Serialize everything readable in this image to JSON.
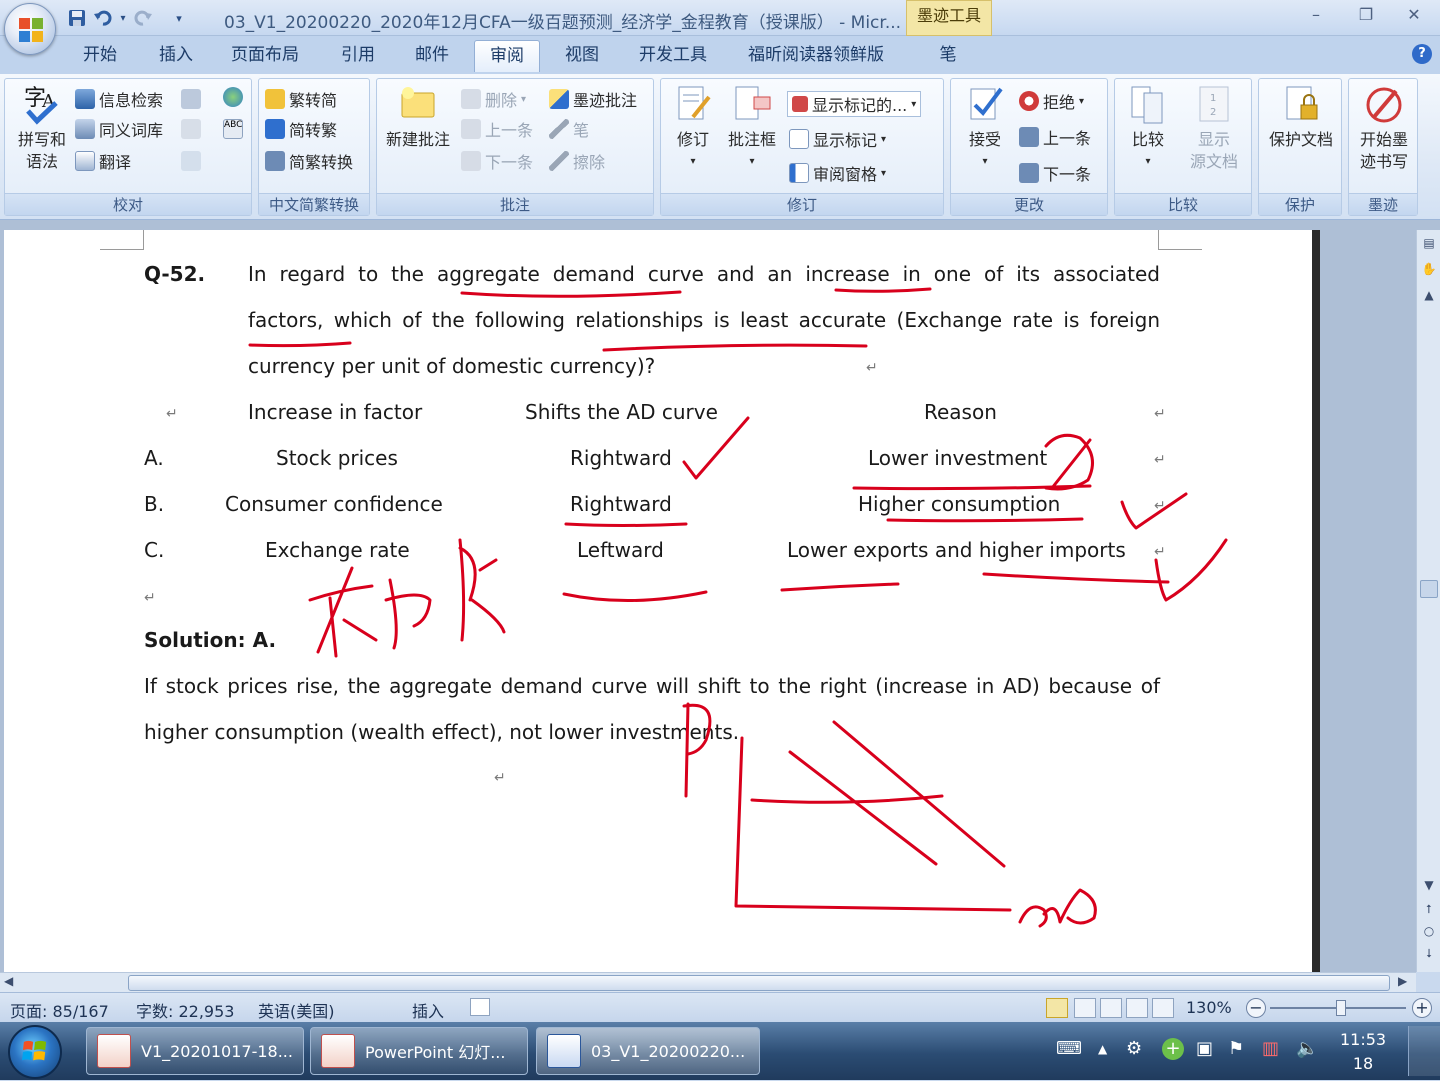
{
  "window": {
    "title": "03_V1_20200220_2020年12月CFA一级百题预测_经济学_金程教育（授课版） - Micr...",
    "contextual_tab": "墨迹工具",
    "controls": [
      "–",
      "❐",
      "✕"
    ]
  },
  "quick_access": [
    "save",
    "undo",
    "redo",
    "customize"
  ],
  "tabs": [
    "开始",
    "插入",
    "页面布局",
    "引用",
    "邮件",
    "审阅",
    "视图",
    "开发工具",
    "福昕阅读器领鲜版",
    "笔"
  ],
  "active_tab": "审阅",
  "ribbon": {
    "proofing": {
      "label": "校对",
      "spelling": [
        "拼写和",
        "语法"
      ],
      "research": "信息检索",
      "thesaurus": "同义词库",
      "translate": "翻译"
    },
    "chinese_conversion": {
      "label": "中文简繁转换",
      "to_simplified": "繁转简",
      "to_traditional": "简转繁",
      "convert": "简繁转换"
    },
    "comments": {
      "label": "批注",
      "new_comment": "新建批注",
      "delete": "删除",
      "previous": "上一条",
      "next": "下一条",
      "ink_comment": "墨迹批注",
      "pen": "笔",
      "erase": "擦除"
    },
    "tracking": {
      "label": "修订",
      "track_changes": "修订",
      "balloons": "批注框",
      "display_markup": "显示标记的...",
      "show_markup": "显示标记",
      "reviewing_pane": "审阅窗格"
    },
    "changes": {
      "label": "更改",
      "accept": "接受",
      "reject": "拒绝",
      "previous": "上一条",
      "next": "下一条"
    },
    "compare": {
      "label": "比较",
      "compare": "比较",
      "show_source": [
        "显示",
        "源文档"
      ]
    },
    "protect": {
      "label": "保护",
      "protect_document": "保护文档"
    },
    "ink": {
      "label": "墨迹",
      "start_inking": [
        "开始墨",
        "迹书写"
      ]
    }
  },
  "document": {
    "question_number": "Q-52.",
    "question_lines": [
      "In regard to the aggregate demand curve and an increase in one of its associated",
      "factors, which of the following relationships is least accurate (Exchange rate is foreign",
      "currency per unit of domestic currency)?"
    ],
    "table_headers": [
      "Increase in factor",
      "Shifts the AD curve",
      "Reason"
    ],
    "options": [
      {
        "letter": "A.",
        "factor": "Stock prices",
        "shift": "Rightward",
        "reason": "Lower investment"
      },
      {
        "letter": "B.",
        "factor": "Consumer confidence",
        "shift": "Rightward",
        "reason": "Higher consumption"
      },
      {
        "letter": "C.",
        "factor": "Exchange rate",
        "shift": "Leftward",
        "reason": "Lower exports and higher imports"
      }
    ],
    "solution_label": "Solution: A.",
    "solution_lines": [
      "If stock prices rise, the aggregate demand curve will shift to the right (increase in AD) because of",
      "higher consumption (wealth effect), not lower investments."
    ],
    "paragraph_mark": "↵",
    "handwriting": {
      "pen_color": "#d8001c",
      "labels": [
        "P",
        "AD"
      ]
    }
  },
  "status_bar": {
    "page": "页面: 85/167",
    "words": "字数: 22,953",
    "language": "英语(美国)",
    "mode": "插入",
    "zoom": "130%"
  },
  "taskbar": {
    "items": [
      {
        "label": "V1_20201017-18..."
      },
      {
        "label": "PowerPoint 幻灯..."
      },
      {
        "label": "03_V1_20200220..."
      }
    ],
    "time": "11:53",
    "date": "18"
  }
}
